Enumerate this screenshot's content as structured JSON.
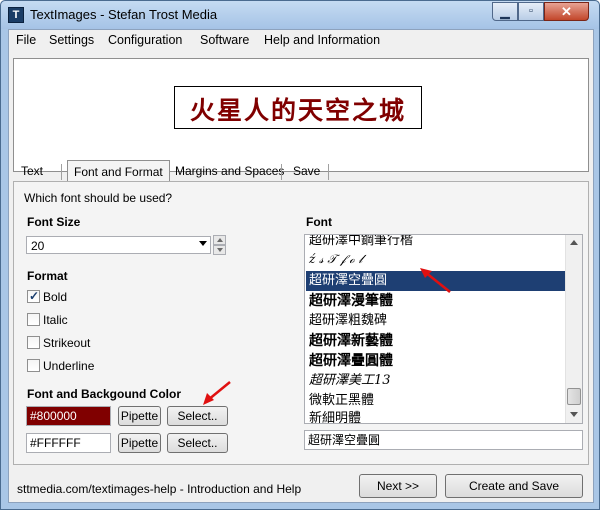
{
  "window": {
    "title": "TextImages - Stefan Trost Media",
    "app_icon": "T",
    "controls": {
      "minimize": "▁",
      "maximize": "▫",
      "close": "✕"
    }
  },
  "menu": [
    "File",
    "Settings",
    "Configuration",
    "Software",
    "Help and Information"
  ],
  "preview": {
    "text": "火星人的天空之城",
    "color": "#800000"
  },
  "tabs": [
    "Text",
    "Font and Format",
    "Margins and Spaces",
    "Save"
  ],
  "active_tab": "Font and Format",
  "panel": {
    "question": "Which font should be used?",
    "font_size": {
      "label": "Font Size",
      "value": "20"
    },
    "format": {
      "label": "Format",
      "options": [
        {
          "label": "Bold",
          "checked": true
        },
        {
          "label": "Italic",
          "checked": false
        },
        {
          "label": "Strikeout",
          "checked": false
        },
        {
          "label": "Underline",
          "checked": false
        }
      ]
    },
    "colors": {
      "label": "Font and Backgound Color",
      "font_color": "#800000",
      "background_color": "#FFFFFF",
      "pipette_label": "Pipette",
      "select_label": "Select.."
    },
    "font": {
      "label": "Font",
      "list": [
        "超研澤中鋼筆行楷",
        "ź 𝓈 𝒯 𝒻 ℴ 𝓁",
        "超研澤空疊圓",
        "超研澤漫筆體",
        "超研澤粗魏碑",
        "超研澤新藝體",
        "超研澤疊圓體",
        "超研澤美工13",
        "微軟正黑體",
        "新細明體"
      ],
      "selected": "超研澤空疊圓",
      "field_value": "超研澤空疊圓"
    }
  },
  "footer": {
    "help_text": "sttmedia.com/textimages-help - Introduction and Help",
    "next_label": "Next >>",
    "create_save_label": "Create and Save"
  }
}
